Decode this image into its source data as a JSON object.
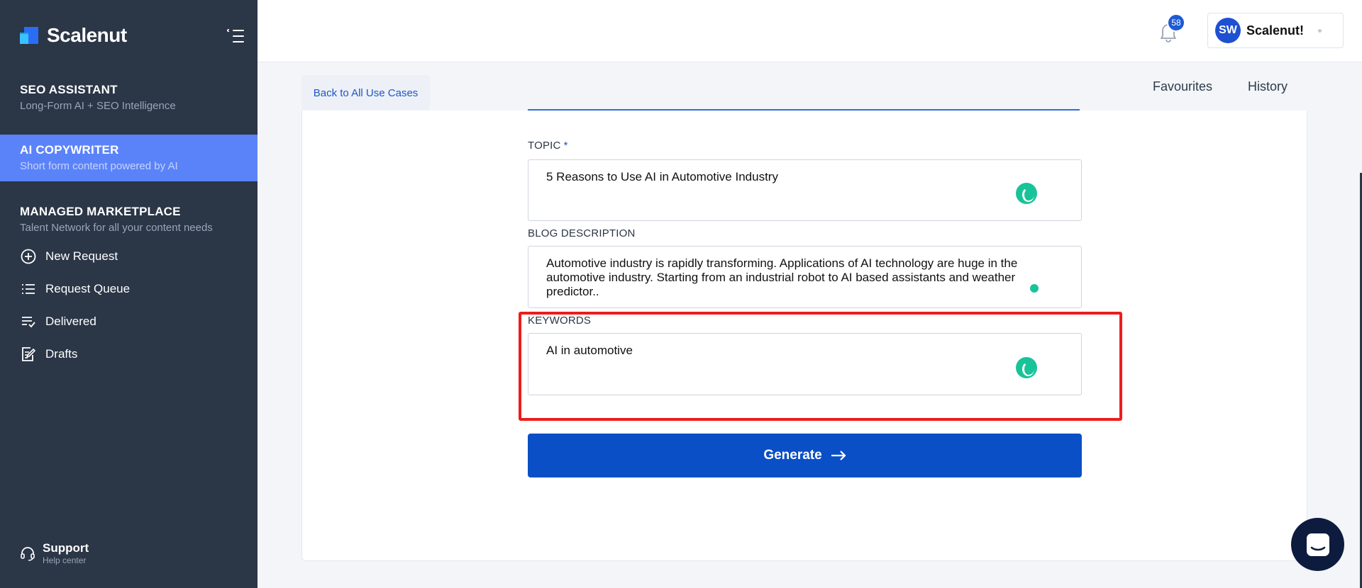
{
  "brand": {
    "name": "Scalenut"
  },
  "sidebar": {
    "sections": [
      {
        "title": "SEO ASSISTANT",
        "subtitle": "Long-Form AI + SEO Intelligence"
      },
      {
        "title": "AI COPYWRITER",
        "subtitle": "Short form content powered by AI"
      },
      {
        "title": "MANAGED MARKETPLACE",
        "subtitle": "Talent Network for all your content needs"
      }
    ],
    "items": [
      {
        "label": "New Request",
        "icon": "plus-circle-icon"
      },
      {
        "label": "Request Queue",
        "icon": "list-icon"
      },
      {
        "label": "Delivered",
        "icon": "checklist-icon"
      },
      {
        "label": "Drafts",
        "icon": "edit-document-icon"
      }
    ],
    "support": {
      "title": "Support",
      "subtitle": "Help center",
      "icon": "headset-icon"
    }
  },
  "header": {
    "notification_count": "58",
    "account": {
      "initials": "SW",
      "name": "Scalenut!"
    }
  },
  "subnav": {
    "back_label": "Back to All Use Cases",
    "links": [
      "Favourites",
      "History"
    ]
  },
  "form": {
    "topic": {
      "label": "TOPIC",
      "required_mark": "*",
      "value": "5 Reasons to Use AI in Automotive Industry"
    },
    "description": {
      "label": "BLOG DESCRIPTION",
      "value": "Automotive industry is rapidly transforming. Applications of AI technology are huge in the automotive industry. Starting from an industrial robot to AI based assistants and weather predictor.."
    },
    "keywords": {
      "label": "KEYWORDS",
      "value": "AI in automotive"
    },
    "generate_label": "Generate"
  },
  "colors": {
    "sidebar_bg": "#2b3647",
    "active_section": "#5b83f9",
    "primary": "#0b4fc6",
    "highlight": "#ee1c1c",
    "spinner": "#19c39a"
  }
}
